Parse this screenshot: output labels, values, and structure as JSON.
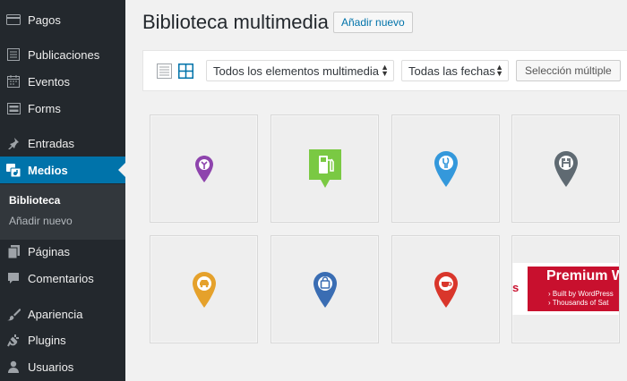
{
  "sidebar": {
    "items": [
      {
        "label": "Pagos",
        "icon": "card-icon"
      },
      {
        "label": "Publicaciones",
        "icon": "list-icon"
      },
      {
        "label": "Eventos",
        "icon": "calendar-icon"
      },
      {
        "label": "Forms",
        "icon": "form-icon"
      },
      {
        "label": "Entradas",
        "icon": "pin-icon"
      },
      {
        "label": "Medios",
        "icon": "media-icon"
      },
      {
        "label": "Páginas",
        "icon": "page-icon"
      },
      {
        "label": "Comentarios",
        "icon": "comment-icon"
      },
      {
        "label": "Apariencia",
        "icon": "brush-icon"
      },
      {
        "label": "Plugins",
        "icon": "plug-icon"
      },
      {
        "label": "Usuarios",
        "icon": "user-icon"
      }
    ],
    "submenu": [
      "Biblioteca",
      "Añadir nuevo"
    ]
  },
  "header": {
    "title": "Biblioteca multimedia",
    "add_new": "Añadir nuevo"
  },
  "toolbar": {
    "filter_type": "Todos los elementos multimedia",
    "filter_date": "Todas las fechas",
    "bulk_select": "Selección múltiple"
  },
  "colors": {
    "sidebar": "#23282d",
    "accent": "#0073aa"
  },
  "media": [
    {
      "icon": "tools-pin-icon",
      "color": "#8e44ad"
    },
    {
      "icon": "gas-station-icon",
      "color": "#7ac943"
    },
    {
      "icon": "restaurant-pin-icon",
      "color": "#3498db"
    },
    {
      "icon": "hotel-pin-icon",
      "color": "#5f6a72"
    },
    {
      "icon": "car-pin-icon",
      "color": "#e5a12b"
    },
    {
      "icon": "shop-pin-icon",
      "color": "#3a6db3"
    },
    {
      "icon": "cafe-pin-icon",
      "color": "#d9362b"
    },
    {
      "icon": "premium-banner-thumb",
      "color": "#c8102e"
    }
  ],
  "banner": {
    "title": "Premium W",
    "line1": "› Built by WordPress",
    "line2": "› Thousands of Sat",
    "frag": "s"
  }
}
